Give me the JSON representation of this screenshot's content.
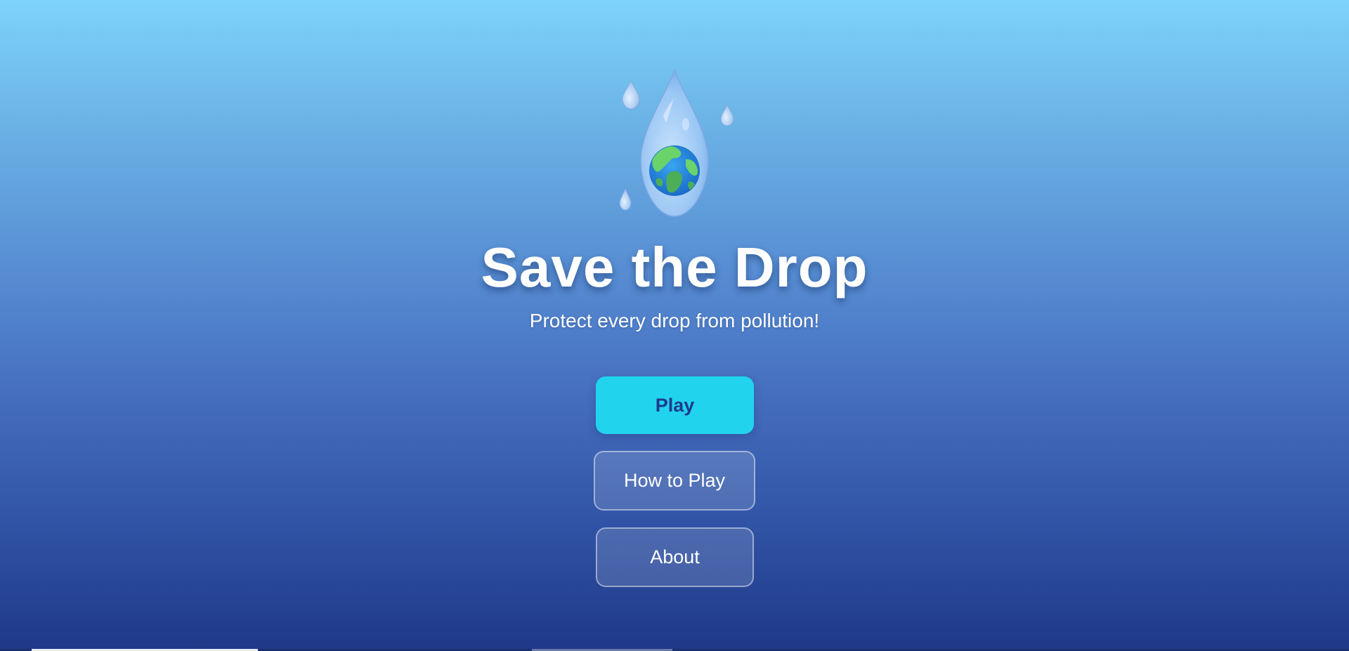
{
  "game": {
    "title": "Save the Drop",
    "subtitle": "Protect every drop from pollution!",
    "logo_icon": "water-drop-earth-icon"
  },
  "menu": {
    "play_label": "Play",
    "how_to_play_label": "How to Play",
    "about_label": "About"
  },
  "colors": {
    "background_top": "#7dd3fb",
    "background_bottom": "#1f3888",
    "play_button": "#22d3ee",
    "play_text": "#1e3a8a",
    "title_text": "#ffffff"
  }
}
